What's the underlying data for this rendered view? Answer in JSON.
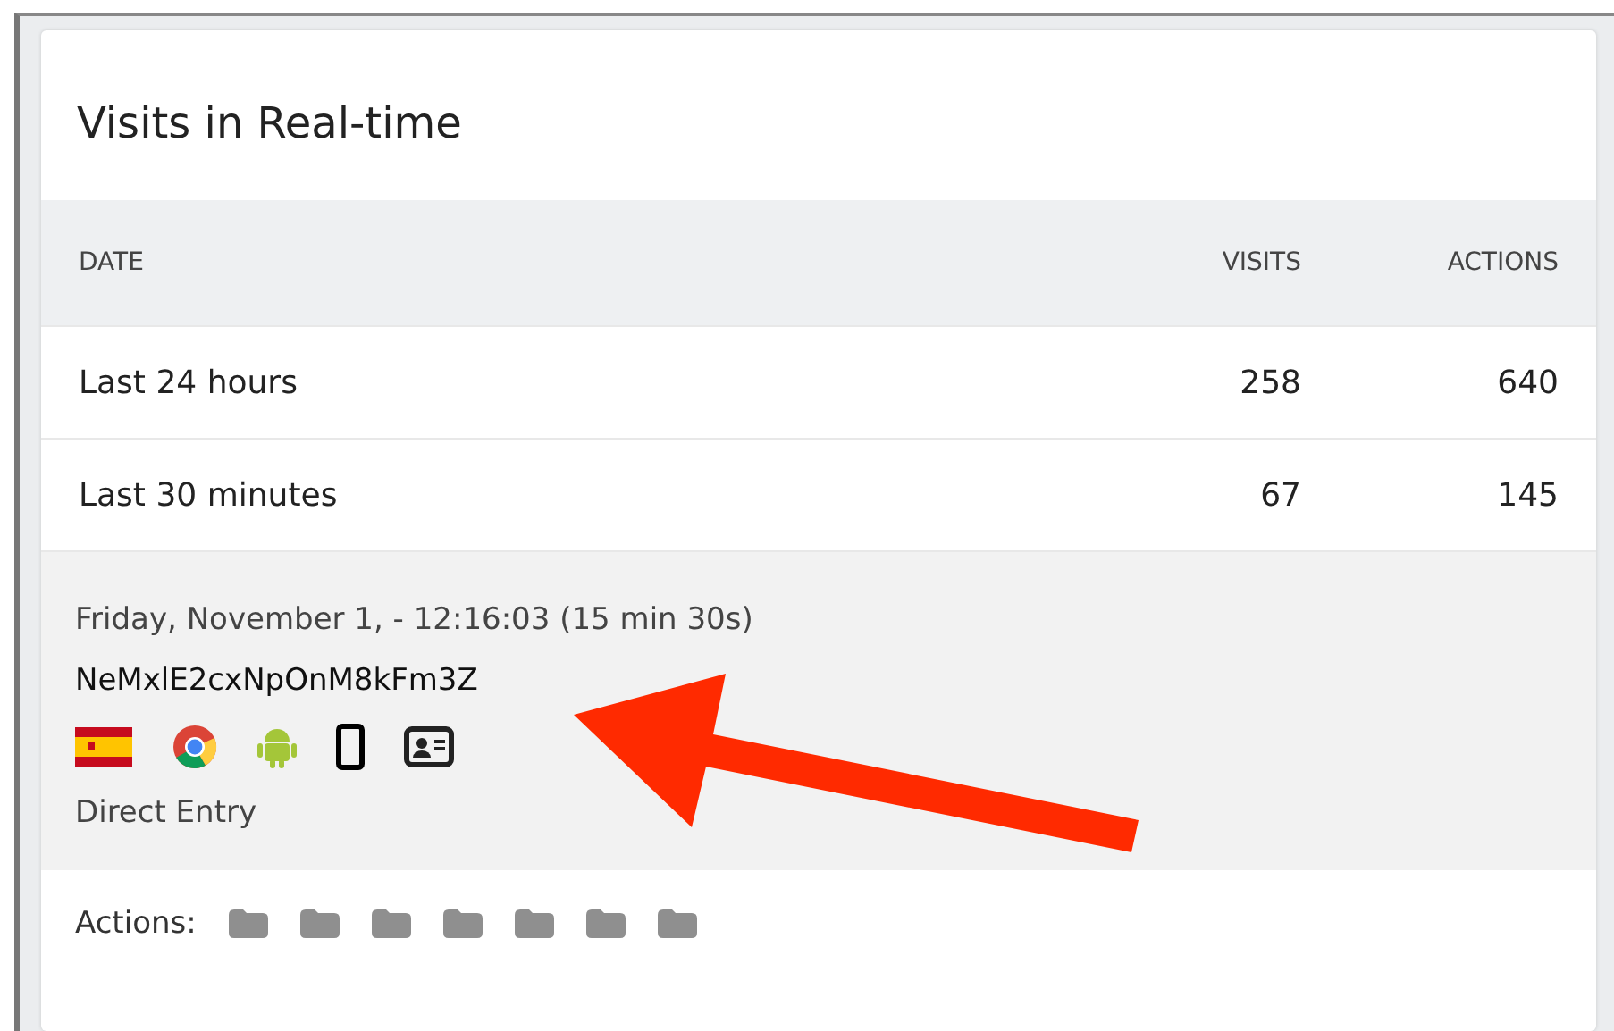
{
  "widget": {
    "title": "Visits in Real-time"
  },
  "table": {
    "columns": [
      "DATE",
      "VISITS",
      "ACTIONS"
    ],
    "rows": [
      {
        "date": "Last 24 hours",
        "visits": "258",
        "actions": "640"
      },
      {
        "date": "Last 30 minutes",
        "visits": "67",
        "actions": "145"
      }
    ]
  },
  "visit": {
    "datetime": "Friday, November 1, - 12:16:03 (15 min 30s)",
    "visitor_id": "NeMxlE2cxNpOnM8kFm3Z",
    "icons": [
      {
        "kind": "flag"
      },
      {
        "kind": "browser"
      },
      {
        "kind": "os"
      },
      {
        "kind": "device"
      },
      {
        "kind": "profile"
      }
    ],
    "referrer": "Direct Entry",
    "actions_label": "Actions:",
    "actions": [
      {
        "kind": "folder"
      },
      {
        "kind": "folder"
      },
      {
        "kind": "folder"
      },
      {
        "kind": "folder"
      },
      {
        "kind": "folder"
      },
      {
        "kind": "folder"
      },
      {
        "kind": "folder"
      }
    ]
  }
}
